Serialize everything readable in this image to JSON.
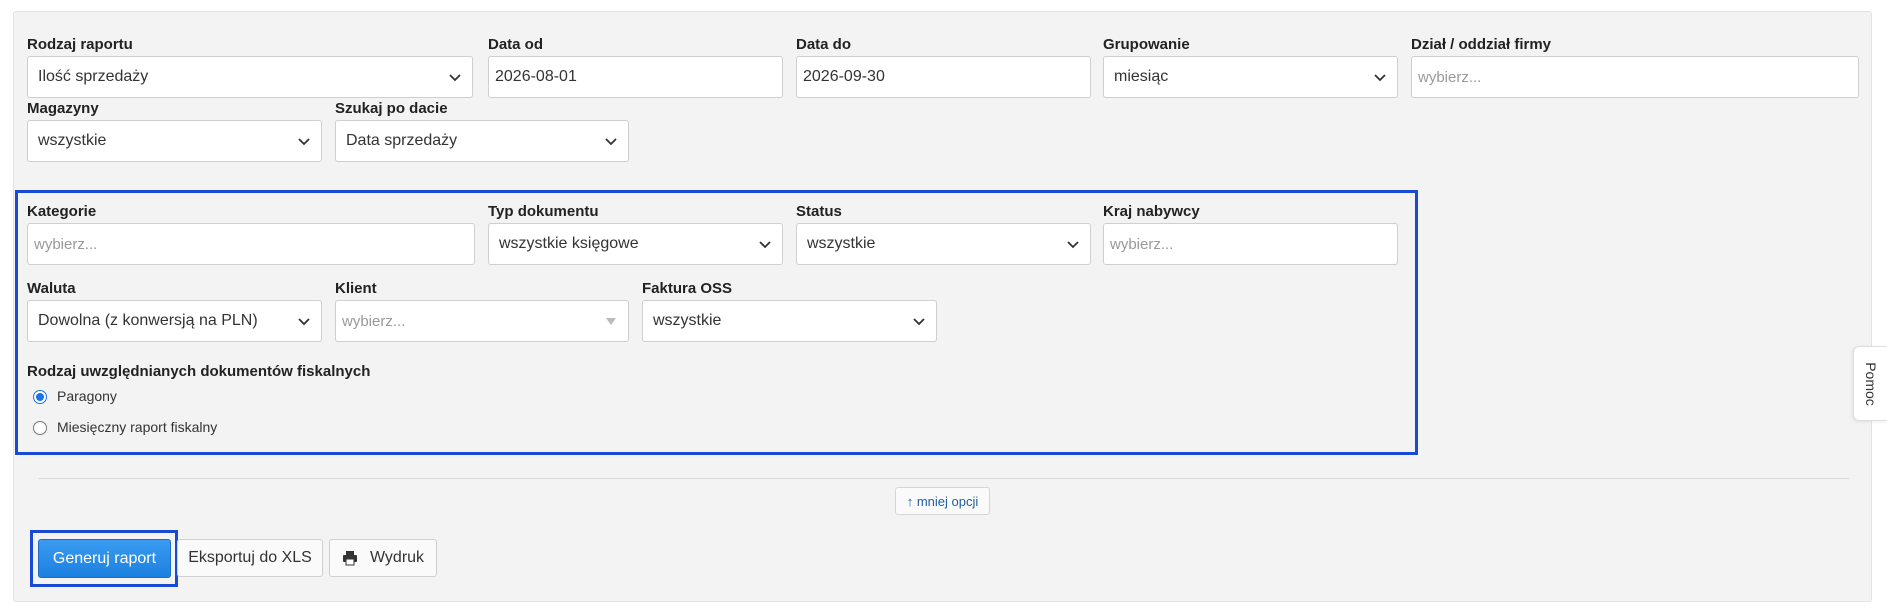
{
  "filters": {
    "report_type": {
      "label": "Rodzaj raportu",
      "value": "Ilość sprzedaży"
    },
    "date_from": {
      "label": "Data od",
      "value": "2026-08-01"
    },
    "date_to": {
      "label": "Data do",
      "value": "2026-09-30"
    },
    "grouping": {
      "label": "Grupowanie",
      "value": "miesiąc"
    },
    "department": {
      "label": "Dział / oddział firmy",
      "placeholder": "wybierz..."
    },
    "warehouses": {
      "label": "Magazyny",
      "value": "wszystkie"
    },
    "search_by_date": {
      "label": "Szukaj po dacie",
      "value": "Data sprzedaży"
    }
  },
  "extra": {
    "categories": {
      "label": "Kategorie",
      "placeholder": "wybierz..."
    },
    "doc_type": {
      "label": "Typ dokumentu",
      "value": "wszystkie księgowe"
    },
    "status": {
      "label": "Status",
      "value": "wszystkie"
    },
    "buyer_country": {
      "label": "Kraj nabywcy",
      "placeholder": "wybierz..."
    },
    "currency": {
      "label": "Waluta",
      "value": "Dowolna (z konwersją na PLN)"
    },
    "client": {
      "label": "Klient",
      "placeholder": "wybierz..."
    },
    "oss_invoice": {
      "label": "Faktura OSS",
      "value": "wszystkie"
    },
    "fiscal": {
      "label": "Rodzaj uwzględnianych dokumentów fiskalnych",
      "options": [
        {
          "label": "Paragony",
          "selected": true
        },
        {
          "label": "Miesięczny raport fiskalny",
          "selected": false
        }
      ]
    }
  },
  "less_options_label": "↑ mniej opcji",
  "actions": {
    "generate": "Generuj raport",
    "export_xls": "Eksportuj do XLS",
    "print": "Wydruk"
  },
  "help_tab": "Pomoc",
  "colors": {
    "highlight_border": "#1a49d6",
    "primary_button": "#1c80e0",
    "link": "#1f5fa8"
  },
  "icons": {
    "dropdown": "chevron-down-icon",
    "print": "printer-icon",
    "combo": "triangle-down-icon"
  }
}
